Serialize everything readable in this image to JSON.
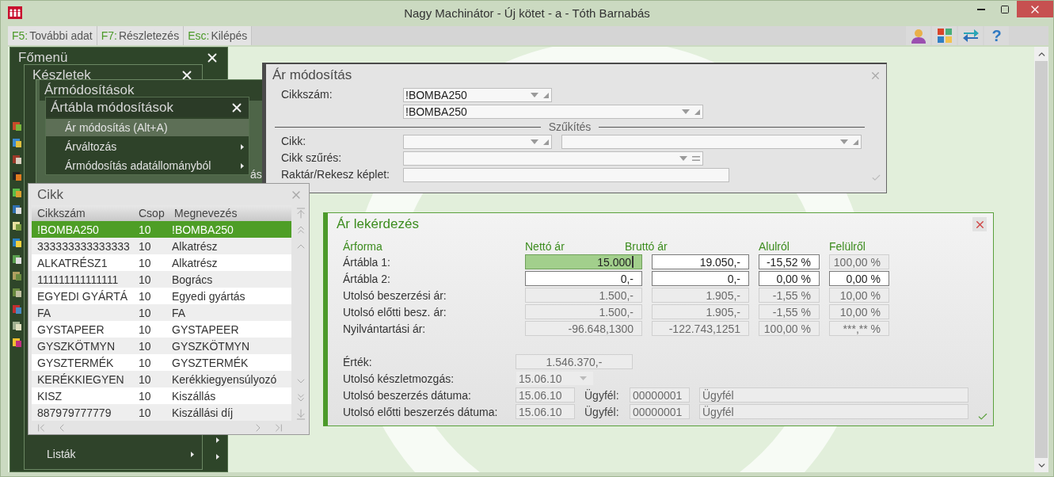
{
  "window": {
    "title": "Nagy Machinátor - Új kötet - a - Tóth Barnabás"
  },
  "toolbar": {
    "hotkeys": [
      {
        "key": "F5:",
        "label": "További adat"
      },
      {
        "key": "F7:",
        "label": "Részletezés"
      },
      {
        "key": "Esc:",
        "label": "Kilépés"
      }
    ],
    "help": "?"
  },
  "menus": [
    {
      "title": "Főmenü",
      "items": [
        {
          "selected": false,
          "submenu": true
        },
        {
          "selected": false,
          "submenu": true
        }
      ]
    },
    {
      "title": "Készletek",
      "items": [
        {
          "label": "Listák",
          "selected": false,
          "submenu": true
        }
      ]
    },
    {
      "title": "Ármódosítások",
      "items": [
        {
          "label": "ás",
          "selected": false,
          "submenu": false
        }
      ]
    },
    {
      "title": "Ártábla módosítások",
      "items": [
        {
          "label": "Ár módosítás (Alt+A)",
          "selected": true,
          "submenu": false
        },
        {
          "label": "Árváltozás",
          "selected": false,
          "submenu": true
        },
        {
          "label": "Ármódosítás adatállományból",
          "selected": false,
          "submenu": true
        }
      ]
    }
  ],
  "price_edit": {
    "title": "Ár módosítás",
    "article": {
      "label": "Cikkszám:",
      "code": "!BOMBA250",
      "name": "!BOMBA250"
    },
    "section": "Szűkítés",
    "filters": [
      {
        "label": "Cikk:",
        "kind": "double"
      },
      {
        "label": "Cikk szűrés:",
        "kind": "filter"
      },
      {
        "label": "Raktár/Rekesz képlet:",
        "kind": "text"
      }
    ]
  },
  "article_list": {
    "title": "Cikk",
    "columns": [
      "Cikkszám",
      "Csop",
      "Megnevezés"
    ],
    "rows": [
      {
        "cells": [
          "!BOMBA250",
          "10",
          "!BOMBA250"
        ],
        "selected": true
      },
      {
        "cells": [
          "333333333333333",
          "10",
          "Alkatrész"
        ],
        "selected": false
      },
      {
        "cells": [
          "ALKATRÉSZ1",
          "10",
          "Alkatrész"
        ],
        "selected": false
      },
      {
        "cells": [
          "111111111111111",
          "10",
          "Bogrács"
        ],
        "selected": false
      },
      {
        "cells": [
          "EGYEDI GYÁRTÁ",
          "10",
          "Egyedi gyártás"
        ],
        "selected": false
      },
      {
        "cells": [
          "FA",
          "10",
          "FA"
        ],
        "selected": false
      },
      {
        "cells": [
          "GYSTAPEER",
          "10",
          "GYSTAPEER"
        ],
        "selected": false
      },
      {
        "cells": [
          "GYSZKÖTMYN",
          "10",
          "GYSZKÖTMYN"
        ],
        "selected": false
      },
      {
        "cells": [
          "GYSZTERMÉK",
          "10",
          "GYSZTERMÉK"
        ],
        "selected": false
      },
      {
        "cells": [
          "KERÉKKIEGYEN",
          "10",
          "Kerékkiegyensúlyozó"
        ],
        "selected": false
      },
      {
        "cells": [
          "KISZ",
          "10",
          "Kiszállás"
        ],
        "selected": false
      },
      {
        "cells": [
          "887979777779",
          "10",
          "Kiszállási díj"
        ],
        "selected": false
      }
    ]
  },
  "price_query": {
    "title": "Ár lekérdezés",
    "headers": [
      "Árforma",
      "Nettó ár",
      "Bruttó ár",
      "Alulról",
      "Felülről"
    ],
    "rows": [
      {
        "label": "Ártábla 1:",
        "cells": [
          {
            "text": "15.000",
            "kind": "active"
          },
          {
            "text": "19.050,-",
            "kind": "editable"
          },
          {
            "text": "-15,52 %",
            "kind": "editable"
          },
          {
            "text": "100,00 %",
            "kind": "readonly"
          }
        ]
      },
      {
        "label": "Ártábla 2:",
        "cells": [
          {
            "text": "0,-",
            "kind": "editable"
          },
          {
            "text": "0,-",
            "kind": "editable"
          },
          {
            "text": "0,00 %",
            "kind": "editable"
          },
          {
            "text": "0,00 %",
            "kind": "editable"
          }
        ]
      },
      {
        "label": "Utolsó beszerzési ár:",
        "cells": [
          {
            "text": "1.500,-",
            "kind": "readonly"
          },
          {
            "text": "1.905,-",
            "kind": "readonly"
          },
          {
            "text": "-1,55 %",
            "kind": "readonly"
          },
          {
            "text": "10,00 %",
            "kind": "readonly"
          }
        ]
      },
      {
        "label": "Utolsó előtti besz. ár:",
        "cells": [
          {
            "text": "1.500,-",
            "kind": "readonly"
          },
          {
            "text": "1.905,-",
            "kind": "readonly"
          },
          {
            "text": "-1,55 %",
            "kind": "readonly"
          },
          {
            "text": "10,00 %",
            "kind": "readonly"
          }
        ]
      },
      {
        "label": "Nyilvántartási ár:",
        "cells": [
          {
            "text": "-96.648,1300",
            "kind": "readonly"
          },
          {
            "text": "-122.743,1251",
            "kind": "readonly"
          },
          {
            "text": "100,00 %",
            "kind": "readonly"
          },
          {
            "text": "***,** %",
            "kind": "readonly"
          }
        ]
      }
    ],
    "value": {
      "label": "Érték:",
      "text": "1.546.370,-"
    },
    "movement": {
      "label": "Utolsó készletmozgás:",
      "value": "15.06.10"
    },
    "purchases": [
      {
        "label": "Utolsó beszerzés dátuma:",
        "date": "15.06.10",
        "client_label": "Ügyfél:",
        "client_code": "00000001",
        "client_name": "Ügyfél"
      },
      {
        "label": "Utolsó előtti beszerzés dátuma:",
        "date": "15.06.10",
        "client_label": "Ügyfél:",
        "client_code": "00000001",
        "client_name": "Ügyfél"
      }
    ]
  }
}
